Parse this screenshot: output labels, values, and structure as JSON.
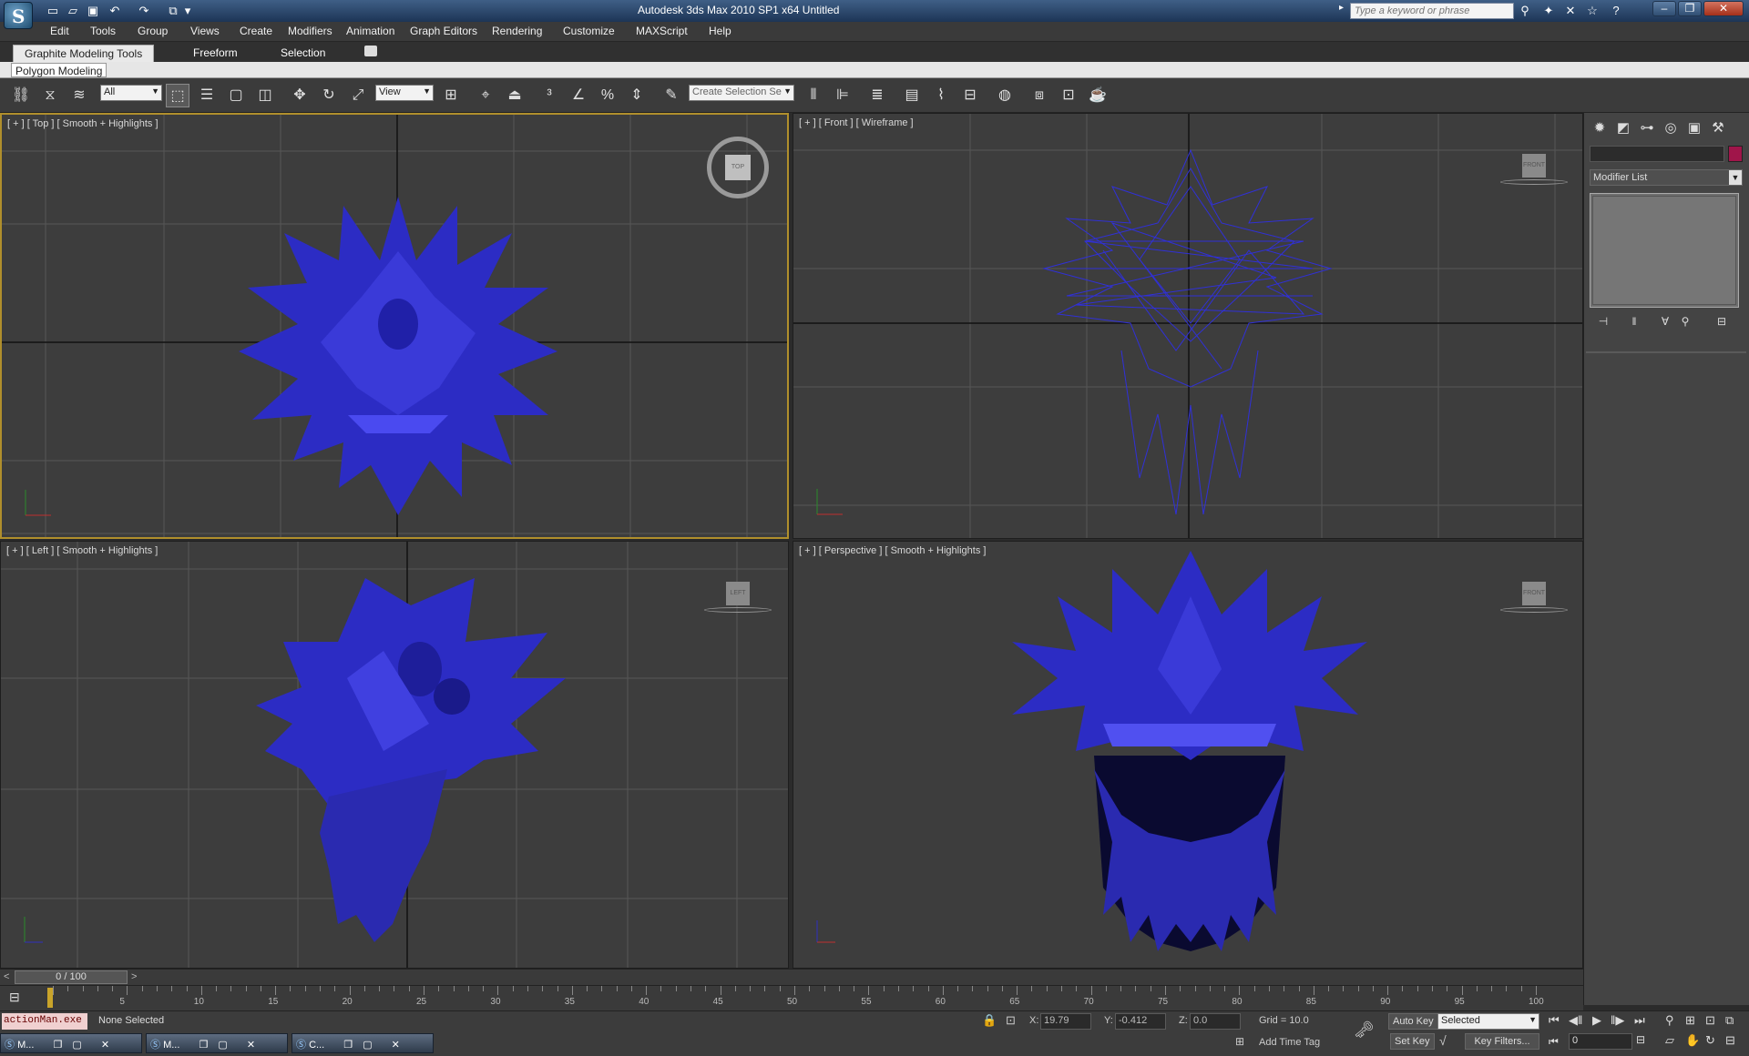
{
  "window": {
    "title": "Autodesk 3ds Max  2010 SP1 x64       Untitled",
    "search_placeholder": "Type a keyword or phrase"
  },
  "menu": [
    "Edit",
    "Tools",
    "Group",
    "Views",
    "Create",
    "Modifiers",
    "Animation",
    "Graph Editors",
    "Rendering",
    "Customize",
    "MAXScript",
    "Help"
  ],
  "ribbon": {
    "tabs": [
      "Graphite Modeling Tools",
      "Freeform",
      "Selection"
    ],
    "panel_label": "Polygon Modeling"
  },
  "toolbar": {
    "filter_value": "All",
    "refcoord_value": "View",
    "named_selection_placeholder": "Create Selection Se"
  },
  "viewports": {
    "top": {
      "label": "[ + ] [ Top ] [ Smooth + Highlights ]",
      "cube": "TOP"
    },
    "front": {
      "label": "[ + ] [ Front ] [ Wireframe ]",
      "cube": "FRONT"
    },
    "left": {
      "label": "[ + ] [ Left ] [ Smooth + Highlights ]",
      "cube": "LEFT"
    },
    "perspective": {
      "label": "[ + ] [ Perspective ] [ Smooth + Highlights ]",
      "cube": "FRONT"
    }
  },
  "command_panel": {
    "modifier_list": "Modifier List",
    "object_color": "#a0154a"
  },
  "timeline": {
    "slider_value": "0 / 100",
    "ticks": [
      "5",
      "10",
      "15",
      "20",
      "25",
      "30",
      "35",
      "40",
      "45",
      "50",
      "55",
      "60",
      "65",
      "70",
      "75",
      "80",
      "85",
      "90",
      "95",
      "100"
    ]
  },
  "status": {
    "script_listener": "actionMan.exe",
    "selection": "None Selected",
    "x_label": "X:",
    "x_value": "19.79",
    "y_label": "Y:",
    "y_value": "-0.412",
    "z_label": "Z:",
    "z_value": "0.0",
    "grid": "Grid = 10.0",
    "add_time_tag": "Add Time Tag",
    "auto_key": "Auto Key",
    "set_key": "Set Key",
    "key_mode_value": "Selected",
    "key_filters": "Key Filters...",
    "frame_value": "0"
  },
  "taskbar": [
    "M...",
    "M...",
    "C..."
  ],
  "colors": {
    "mesh": "#2f2fc8",
    "viewport_bg": "#3d3d3d",
    "grid": "#5a5a5a",
    "active_border": "#b08f2c"
  }
}
